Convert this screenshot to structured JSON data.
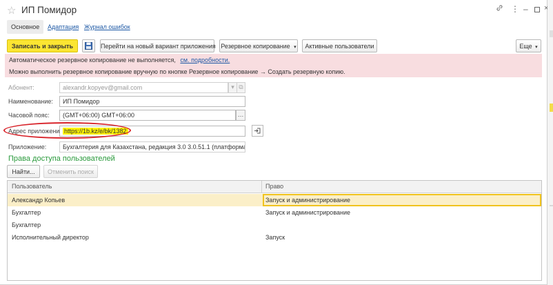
{
  "window": {
    "title": "ИП Помидор",
    "link_icon": "link-icon",
    "menu_icon": "more-vertical-icon",
    "minimize_icon": "minimize-icon",
    "maximize_icon": "maximize-icon",
    "close_icon": "close-icon"
  },
  "tabs": [
    {
      "label": "Основное",
      "active": true
    },
    {
      "label": "Адаптация",
      "active": false
    },
    {
      "label": "Журнал ошибок",
      "active": false
    }
  ],
  "toolbar": {
    "save_close": "Записать и закрыть",
    "save_icon": "floppy-disk-icon",
    "new_variant": "Перейти на новый вариант приложения",
    "backup": "Резервное копирование",
    "active_users": "Активные пользователи",
    "more": "Еще"
  },
  "alert": {
    "line1": "Автоматическое резервное копирование не выполняется,",
    "line1_link": "см. подробности.",
    "line2": "Можно выполнить резервное копирование вручную по кнопке Резервное копирование → Создать резервную копию."
  },
  "form": {
    "subscriber_label": "Абонент:",
    "subscriber_value": "alexandr.kopyev@gmail.com",
    "name_label": "Наименование:",
    "name_value": "ИП Помидор",
    "timezone_label": "Часовой пояс:",
    "timezone_value": "(GMT+06:00) GMT+06:00",
    "address_label": "Адрес приложения:",
    "address_value": "https://1b.kz/e/bk/1382",
    "app_label": "Приложение:",
    "app_value": "Бухгалтерия для Казахстана, редакция 3.0 3.0.51.1 (платформа 8.3.19"
  },
  "access": {
    "title": "Права доступа пользователей",
    "find": "Найти...",
    "cancel_search": "Отменить поиск",
    "columns": [
      "Пользователь",
      "Право"
    ],
    "rows": [
      {
        "user": "Александр Копьев",
        "right": "Запуск и администрирование"
      },
      {
        "user": "Бухгалтер",
        "right": "Запуск и администрирование"
      },
      {
        "user": "Бухгалтер",
        "right": ""
      },
      {
        "user": "Исполнительный директор",
        "right": "Запуск"
      }
    ]
  },
  "colors": {
    "primary_button": "#fbe532",
    "alert_background": "#f8dde0",
    "section_title": "#2a9a3c",
    "link": "#1f5aa6",
    "highlight": "#fff200",
    "annotation": "#d8232a",
    "selected_row": "#fbefc8"
  }
}
